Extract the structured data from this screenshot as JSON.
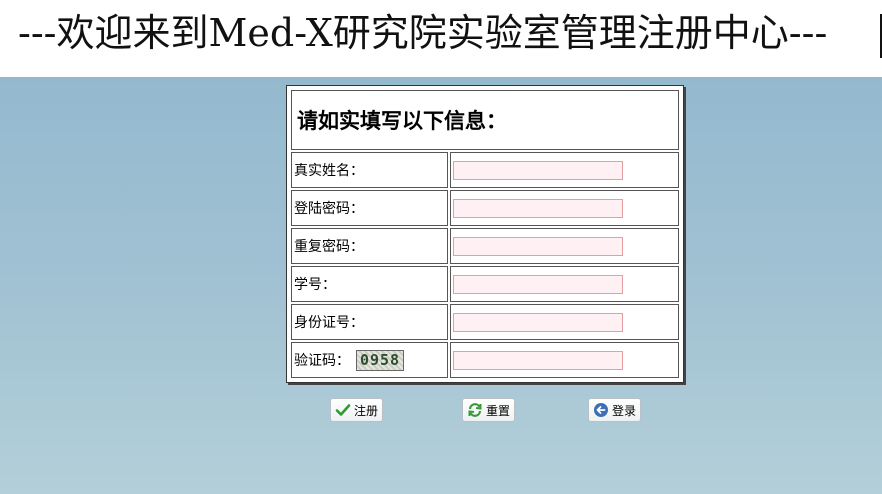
{
  "banner": {
    "title": "---欢迎来到Med-X研究院实验室管理注册中心---"
  },
  "form": {
    "header": "请如实填写以下信息：",
    "fields": [
      {
        "label": "真实姓名：",
        "value": ""
      },
      {
        "label": "登陆密码：",
        "value": ""
      },
      {
        "label": "重复密码：",
        "value": ""
      },
      {
        "label": "学号：",
        "value": ""
      },
      {
        "label": "身份证号：",
        "value": ""
      },
      {
        "label": "验证码：",
        "value": ""
      }
    ],
    "captcha_text": "0958"
  },
  "buttons": {
    "register": "注册",
    "reset": "重置",
    "login": "登录"
  },
  "colors": {
    "background": "#9bbdd0",
    "input_border": "#e79ea1",
    "input_fill": "#fff0f3"
  },
  "icons": {
    "register": "checkmark-icon",
    "reset": "refresh-icon",
    "login": "arrow-left-icon"
  }
}
